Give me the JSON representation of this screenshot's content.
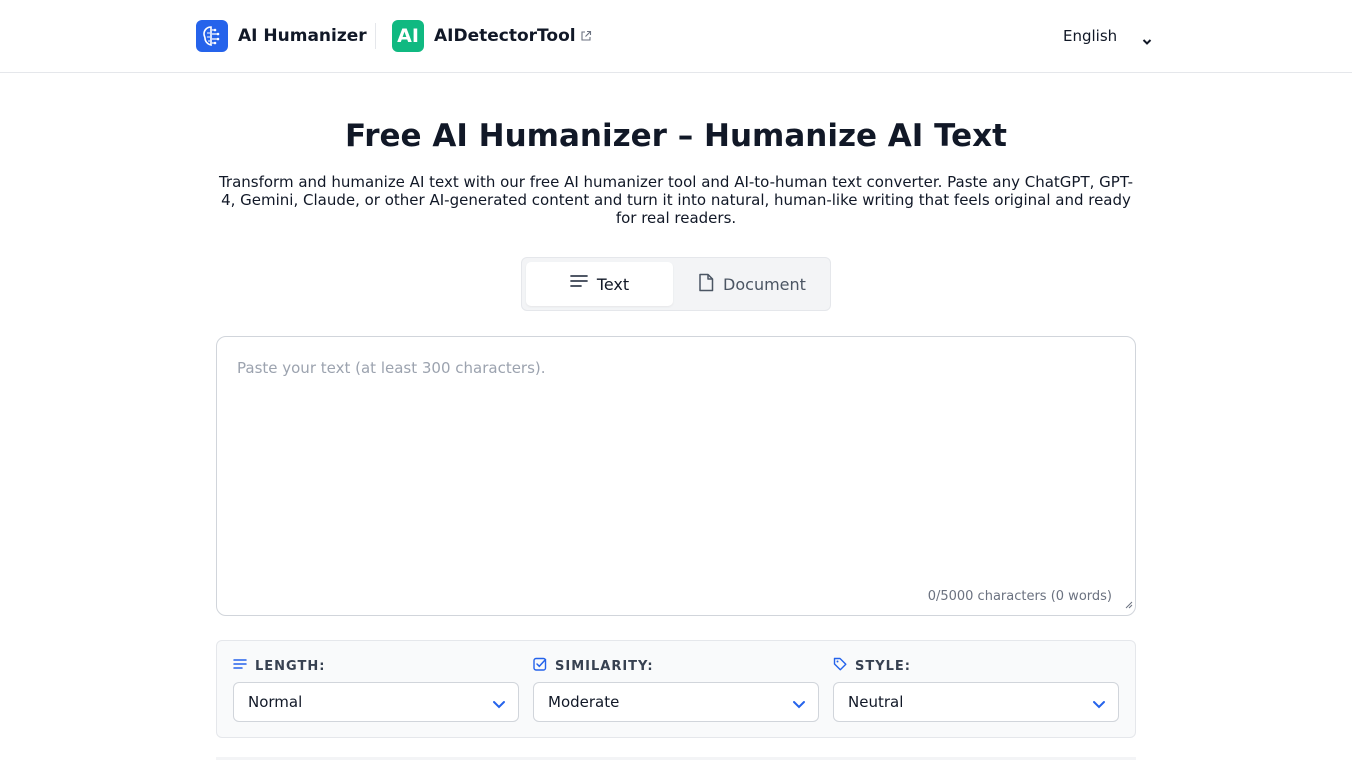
{
  "header": {
    "brand_name": "AI Humanizer",
    "partner_logo_text": "AI",
    "partner_name": "AIDetectorTool",
    "language": "English"
  },
  "hero": {
    "title": "Free AI Humanizer – Humanize AI Text",
    "subtitle": "Transform and humanize AI text with our free AI humanizer tool and AI-to-human text converter. Paste any ChatGPT, GPT-4, Gemini, Claude, or other AI-generated content and turn it into natural, human-like writing that feels original and ready for real readers."
  },
  "tabs": [
    {
      "label": "Text",
      "active": true
    },
    {
      "label": "Document",
      "active": false
    }
  ],
  "editor": {
    "placeholder": "Paste your text (at least 300 characters).",
    "value": "",
    "counter": "0/5000 characters (0 words)"
  },
  "options": {
    "length": {
      "label": "LENGTH:",
      "value": "Normal"
    },
    "similarity": {
      "label": "SIMILARITY:",
      "value": "Moderate"
    },
    "style": {
      "label": "STYLE:",
      "value": "Neutral"
    }
  },
  "colors": {
    "brand_blue": "#2563eb",
    "partner_green": "#10b981",
    "accent_blue": "#2563eb"
  },
  "icons": {
    "brand_logo": "brain-circuit-icon",
    "external_link": "external-link-icon",
    "text_tab": "text-lines-icon",
    "document_tab": "document-icon",
    "length": "lines-icon",
    "similarity": "checkbox-icon",
    "style": "tag-icon"
  }
}
